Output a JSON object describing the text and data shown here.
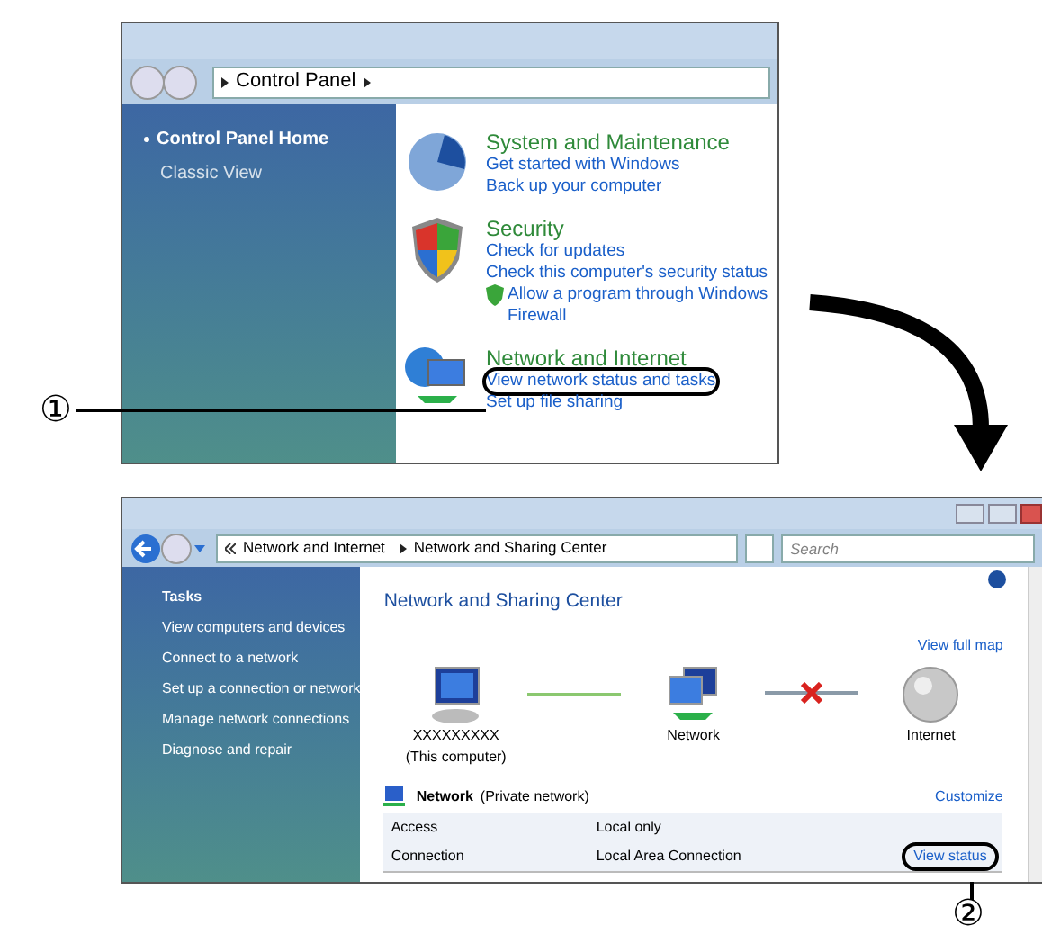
{
  "window_1": {
    "breadcrumb": [
      "Control Panel"
    ],
    "sidebar": [
      {
        "label": "Control Panel Home",
        "selected": true
      },
      {
        "label": "Classic View",
        "selected": false
      }
    ],
    "categories": [
      {
        "kind": "system",
        "title": "System and Maintenance",
        "links": [
          {
            "text": "Get started with Windows",
            "kind": "plain"
          },
          {
            "text": "Back up your computer",
            "kind": "plain"
          }
        ]
      },
      {
        "kind": "security",
        "title": "Security",
        "links": [
          {
            "text": "Check for updates",
            "kind": "plain"
          },
          {
            "text": "Check this computer's security status",
            "kind": "plain"
          },
          {
            "text": "Allow a program through Windows Firewall",
            "kind": "shield"
          }
        ]
      },
      {
        "kind": "network",
        "title": "Network and Internet",
        "links": [
          {
            "text": "View network status and tasks",
            "kind": "plain",
            "highlighted": true
          },
          {
            "text": "Set up file sharing",
            "kind": "plain",
            "highlighted": false
          }
        ]
      }
    ]
  },
  "window_2": {
    "breadcrumb": [
      "Network and Internet",
      "Network and Sharing Center"
    ],
    "search": {
      "placeholder": "Search"
    },
    "sidebar": {
      "title": "Tasks",
      "items": [
        "View computers and devices",
        "Connect to a network",
        "Set up a connection or network",
        "Manage network connections",
        "Diagnose and repair"
      ]
    },
    "heading": "Network and Sharing Center",
    "view_full_map": "View full map",
    "map": {
      "nodes": [
        {
          "kind": "computer",
          "label": "XXXXXXXXX",
          "sublabel": "(This computer)"
        },
        {
          "kind": "network",
          "label": "Network"
        },
        {
          "kind": "internet",
          "label": "Internet"
        }
      ],
      "links": [
        {
          "connected": true
        },
        {
          "connected": false
        }
      ]
    },
    "network": {
      "name": "Network",
      "type": "(Private network)",
      "customize": "Customize",
      "rows": [
        {
          "label": "Access",
          "value": "Local only"
        },
        {
          "label": "Connection",
          "value": "Local Area Connection",
          "action": "View status",
          "highlighted": true
        }
      ]
    }
  },
  "callouts": [
    "①",
    "②"
  ]
}
